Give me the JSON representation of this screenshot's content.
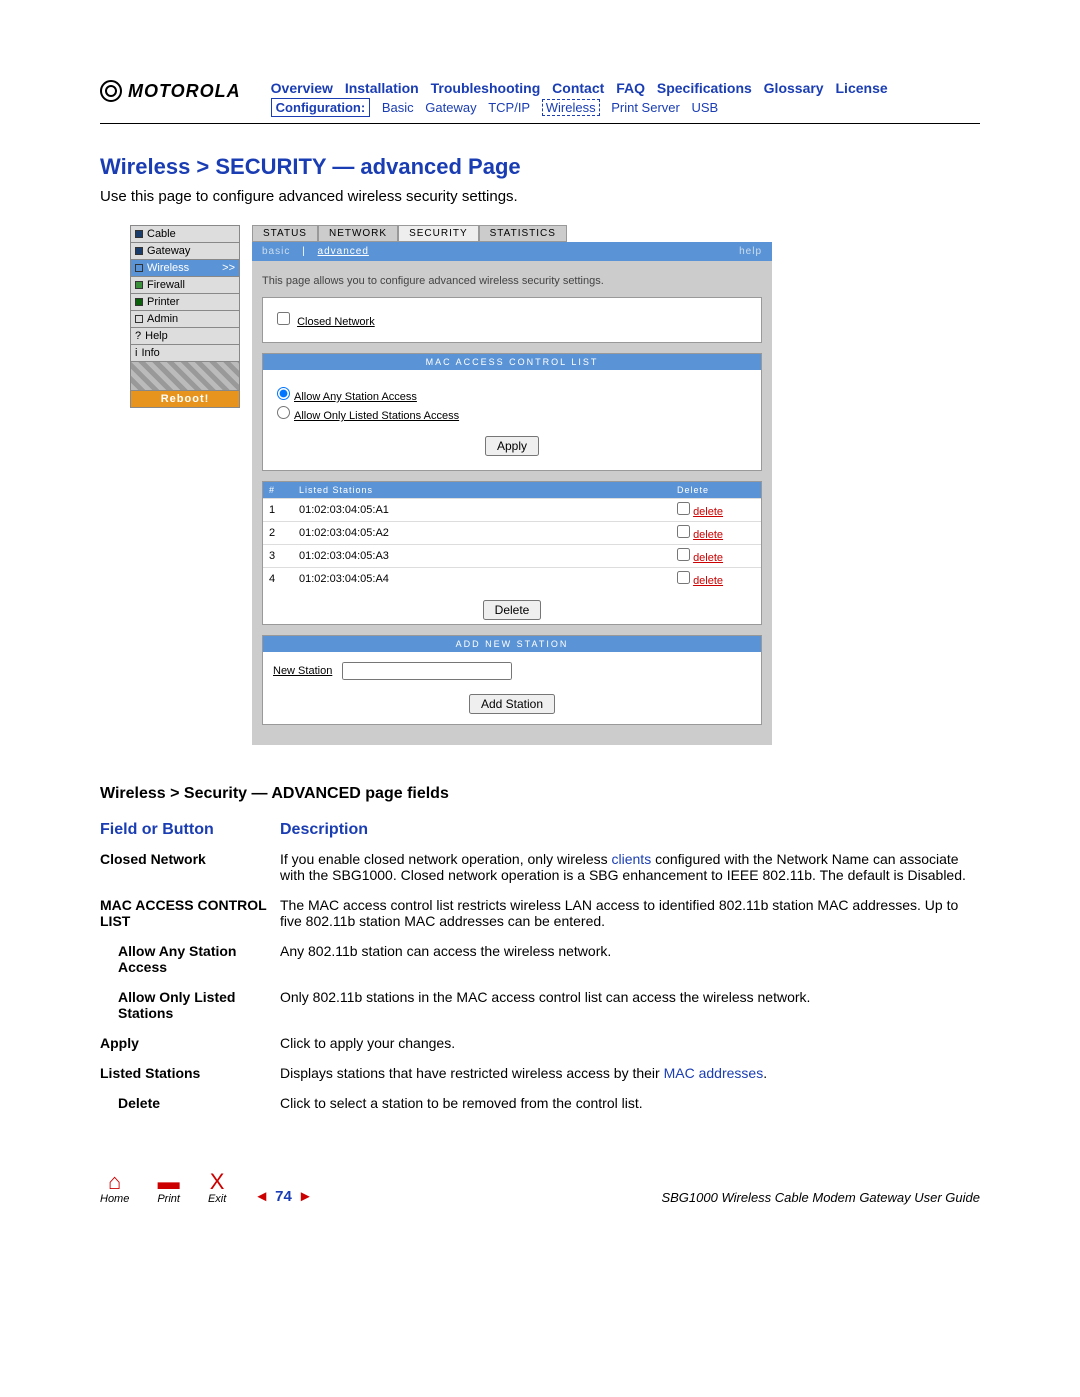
{
  "header": {
    "logo": "MOTOROLA",
    "topnav": [
      "Overview",
      "Installation",
      "Troubleshooting",
      "Contact",
      "FAQ",
      "Specifications",
      "Glossary",
      "License"
    ],
    "subnav_label": "Configuration:",
    "subnav": [
      "Basic",
      "Gateway",
      "TCP/IP",
      "Wireless",
      "Print Server",
      "USB"
    ],
    "subnav_selected": "Wireless"
  },
  "title": "Wireless > SECURITY — advanced Page",
  "intro": "Use this page to configure advanced wireless security settings.",
  "sidenav": {
    "items": [
      {
        "label": "Cable",
        "sq": "navy"
      },
      {
        "label": "Gateway",
        "sq": "navy"
      },
      {
        "label": "Wireless",
        "sq": "blue",
        "selected": true,
        "chev": ">>"
      },
      {
        "label": "Firewall",
        "sq": "green"
      },
      {
        "label": "Printer",
        "sq": "dgreen"
      },
      {
        "label": "Admin",
        "sq": ""
      },
      {
        "label": "Help",
        "sq": "",
        "prefix": "?"
      },
      {
        "label": "Info",
        "sq": "",
        "prefix": "i"
      }
    ],
    "reboot": "Reboot!"
  },
  "panel": {
    "tabs": [
      "STATUS",
      "NETWORK",
      "SECURITY",
      "STATISTICS"
    ],
    "active_tab": "SECURITY",
    "subtabs": {
      "basic": "basic",
      "advanced": "advanced",
      "help": "help"
    },
    "desc": "This page allows you to configure advanced wireless security settings.",
    "closed_network": "Closed Network",
    "macl_header": "MAC ACCESS CONTROL LIST",
    "radio1": "Allow Any Station Access",
    "radio2": "Allow Only Listed Stations Access",
    "apply": "Apply",
    "table": {
      "cols": [
        "#",
        "Listed Stations",
        "Delete"
      ],
      "rows": [
        {
          "n": "1",
          "mac": "01:02:03:04:05:A1"
        },
        {
          "n": "2",
          "mac": "01:02:03:04:05:A2"
        },
        {
          "n": "3",
          "mac": "01:02:03:04:05:A3"
        },
        {
          "n": "4",
          "mac": "01:02:03:04:05:A4"
        }
      ],
      "delete_label": "delete"
    },
    "delete_btn": "Delete",
    "addnew_header": "ADD NEW STATION",
    "new_station_label": "New Station",
    "add_station_btn": "Add Station"
  },
  "fields": {
    "section_title": "Wireless > Security — ADVANCED page fields",
    "col1": "Field or Button",
    "col2": "Description",
    "rows": [
      {
        "label": "Closed Network",
        "desc_pre": "If you enable closed network operation, only wireless ",
        "link": "clients",
        "desc_post": " configured with the Network Name can associate with the SBG1000. Closed network operation is a SBG enhancement to IEEE 802.11b. The default is Disabled."
      },
      {
        "label": "MAC ACCESS CONTROL LIST",
        "desc": "The MAC access control list restricts wireless LAN access to identified 802.11b station MAC addresses. Up to five 802.11b station MAC addresses can be entered."
      },
      {
        "label": "Allow Any Station Access",
        "indent": true,
        "desc": "Any 802.11b station can access the wireless network."
      },
      {
        "label": "Allow Only Listed Stations",
        "indent": true,
        "desc": "Only 802.11b stations in the MAC access control list can access the wireless network."
      },
      {
        "label": "Apply",
        "desc": "Click to apply your changes."
      },
      {
        "label": "Listed Stations",
        "desc_pre": "Displays stations that have restricted wireless access by their ",
        "link": "MAC addresses",
        "desc_post": "."
      },
      {
        "label": "Delete",
        "indent": true,
        "desc": "Click to select a station to be removed from the control list."
      }
    ]
  },
  "footer": {
    "home": "Home",
    "print": "Print",
    "exit": "Exit",
    "page": "74",
    "doc": "SBG1000 Wireless Cable Modem Gateway User Guide"
  }
}
